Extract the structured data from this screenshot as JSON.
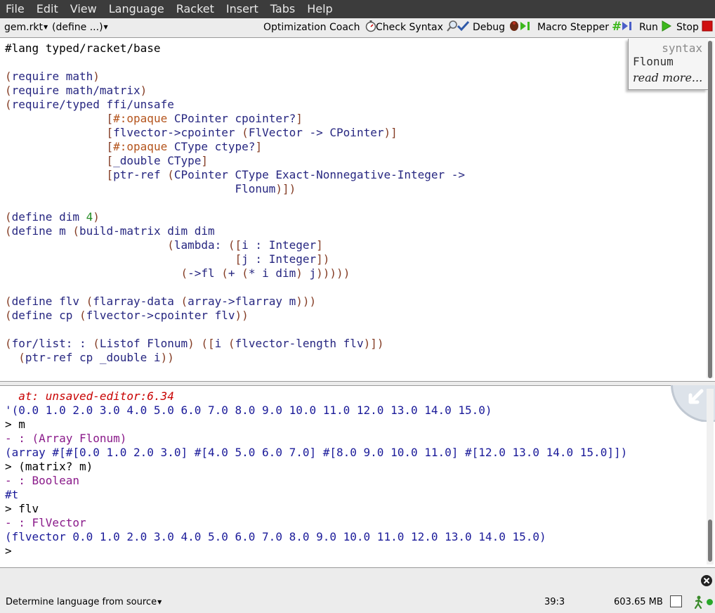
{
  "menubar": [
    "File",
    "Edit",
    "View",
    "Language",
    "Racket",
    "Insert",
    "Tabs",
    "Help"
  ],
  "toolbar": {
    "file_menu": "gem.rkt",
    "define_menu": "(define ...)",
    "optimization_coach": "Optimization Coach",
    "check_syntax": "Check Syntax",
    "debug": "Debug",
    "macro_stepper": "Macro Stepper",
    "run": "Run",
    "stop": "Stop"
  },
  "definitions": {
    "lines": [
      [
        [
          "lang",
          "#lang typed/racket/base"
        ]
      ],
      [],
      [
        [
          "p",
          "("
        ],
        [
          "s",
          "require math"
        ],
        [
          "p",
          ")"
        ]
      ],
      [
        [
          "p",
          "("
        ],
        [
          "s",
          "require math/matrix"
        ],
        [
          "p",
          ")"
        ]
      ],
      [
        [
          "p",
          "("
        ],
        [
          "s",
          "require/typed ffi/unsafe"
        ]
      ],
      [
        [
          "s",
          "               "
        ],
        [
          "p",
          "["
        ],
        [
          "k",
          "#:opaque"
        ],
        [
          "s",
          " CPointer cpointer?"
        ],
        [
          "p",
          "]"
        ]
      ],
      [
        [
          "s",
          "               "
        ],
        [
          "p",
          "["
        ],
        [
          "s",
          "flvector->cpointer "
        ],
        [
          "p",
          "("
        ],
        [
          "s",
          "FlVector -> CPointer"
        ],
        [
          "p",
          ")]"
        ]
      ],
      [
        [
          "s",
          "               "
        ],
        [
          "p",
          "["
        ],
        [
          "k",
          "#:opaque"
        ],
        [
          "s",
          " CType ctype?"
        ],
        [
          "p",
          "]"
        ]
      ],
      [
        [
          "s",
          "               "
        ],
        [
          "p",
          "["
        ],
        [
          "s",
          "_double CType"
        ],
        [
          "p",
          "]"
        ]
      ],
      [
        [
          "s",
          "               "
        ],
        [
          "p",
          "["
        ],
        [
          "s",
          "ptr-ref "
        ],
        [
          "p",
          "("
        ],
        [
          "s",
          "CPointer CType Exact-Nonnegative-Integer ->"
        ]
      ],
      [
        [
          "s",
          "                                  Flonum"
        ],
        [
          "p",
          ")])"
        ]
      ],
      [],
      [
        [
          "p",
          "("
        ],
        [
          "s",
          "define dim "
        ],
        [
          "n",
          "4"
        ],
        [
          "p",
          ")"
        ]
      ],
      [
        [
          "p",
          "("
        ],
        [
          "s",
          "define m "
        ],
        [
          "p",
          "("
        ],
        [
          "s",
          "build-matrix dim dim"
        ]
      ],
      [
        [
          "s",
          "                        "
        ],
        [
          "p",
          "("
        ],
        [
          "s",
          "lambda: "
        ],
        [
          "p",
          "(["
        ],
        [
          "s",
          "i : Integer"
        ],
        [
          "p",
          "]"
        ]
      ],
      [
        [
          "s",
          "                                  "
        ],
        [
          "p",
          "["
        ],
        [
          "s",
          "j : Integer"
        ],
        [
          "p",
          "])"
        ]
      ],
      [
        [
          "s",
          "                          "
        ],
        [
          "p",
          "("
        ],
        [
          "s",
          "->fl "
        ],
        [
          "p",
          "("
        ],
        [
          "s",
          "+ "
        ],
        [
          "p",
          "("
        ],
        [
          "s",
          "* i dim"
        ],
        [
          "p",
          ")"
        ],
        [
          "s",
          " j"
        ],
        [
          "p",
          ")))))"
        ]
      ],
      [],
      [
        [
          "p",
          "("
        ],
        [
          "s",
          "define flv "
        ],
        [
          "p",
          "("
        ],
        [
          "s",
          "flarray-data "
        ],
        [
          "p",
          "("
        ],
        [
          "s",
          "array->flarray m"
        ],
        [
          "p",
          ")))"
        ]
      ],
      [
        [
          "p",
          "("
        ],
        [
          "s",
          "define cp "
        ],
        [
          "p",
          "("
        ],
        [
          "s",
          "flvector->cpointer flv"
        ],
        [
          "p",
          "))"
        ]
      ],
      [],
      [
        [
          "p",
          "("
        ],
        [
          "s",
          "for/list: : "
        ],
        [
          "p",
          "("
        ],
        [
          "s",
          "Listof Flonum"
        ],
        [
          "p",
          ") (["
        ],
        [
          "s",
          "i "
        ],
        [
          "p",
          "("
        ],
        [
          "s",
          "flvector-length flv"
        ],
        [
          "p",
          ")])"
        ]
      ],
      [
        [
          "s",
          "  "
        ],
        [
          "p",
          "("
        ],
        [
          "s",
          "ptr-ref cp _double i"
        ],
        [
          "p",
          "))"
        ]
      ]
    ]
  },
  "bluebox": {
    "title": "syntax",
    "signature": "Flonum",
    "read_more": "read more..."
  },
  "interactions": {
    "lines": [
      [
        [
          "err",
          "  at: unsaved-editor:6.34"
        ]
      ],
      [
        [
          "val",
          "'(0.0 1.0 2.0 3.0 4.0 5.0 6.0 7.0 8.0 9.0 10.0 11.0 12.0 13.0 14.0 15.0)"
        ]
      ],
      [
        [
          "plain",
          "> m"
        ]
      ],
      [
        [
          "ty",
          "- : (Array Flonum)"
        ]
      ],
      [
        [
          "val",
          "(array #[#[0.0 1.0 2.0 3.0] #[4.0 5.0 6.0 7.0] #[8.0 9.0 10.0 11.0] #[12.0 13.0 14.0 15.0]])"
        ]
      ],
      [
        [
          "plain",
          "> (matrix? m)"
        ]
      ],
      [
        [
          "ty",
          "- : Boolean"
        ]
      ],
      [
        [
          "val",
          "#t"
        ]
      ],
      [
        [
          "plain",
          "> flv"
        ]
      ],
      [
        [
          "ty",
          "- : FlVector"
        ]
      ],
      [
        [
          "val",
          "(flvector 0.0 1.0 2.0 3.0 4.0 5.0 6.0 7.0 8.0 9.0 10.0 11.0 12.0 13.0 14.0 15.0)"
        ]
      ],
      [
        [
          "plain",
          "> "
        ]
      ]
    ]
  },
  "status": {
    "language": "Determine language from source",
    "position": "39:3",
    "memory": "603.65 MB"
  },
  "colors": {
    "menubar_bg": "#3c3c3c",
    "paren": "#843c24",
    "symbol": "#262680",
    "keyword": "#b4541c",
    "number": "#228b22",
    "error": "#c80000",
    "type": "#8a1a8a",
    "value": "#1a1a99",
    "run_green": "#3cb81c",
    "stop_red": "#d01010"
  },
  "icons": {
    "optimization_coach": "stopwatch-icon",
    "check_syntax": "magnifier-check-icon",
    "debug": "bug-step-icon",
    "macro_stepper": "hash-step-icon",
    "run": "play-icon",
    "stop": "stop-square-icon",
    "close_search": "close-circle-icon",
    "status_running": "running-man-icon"
  }
}
